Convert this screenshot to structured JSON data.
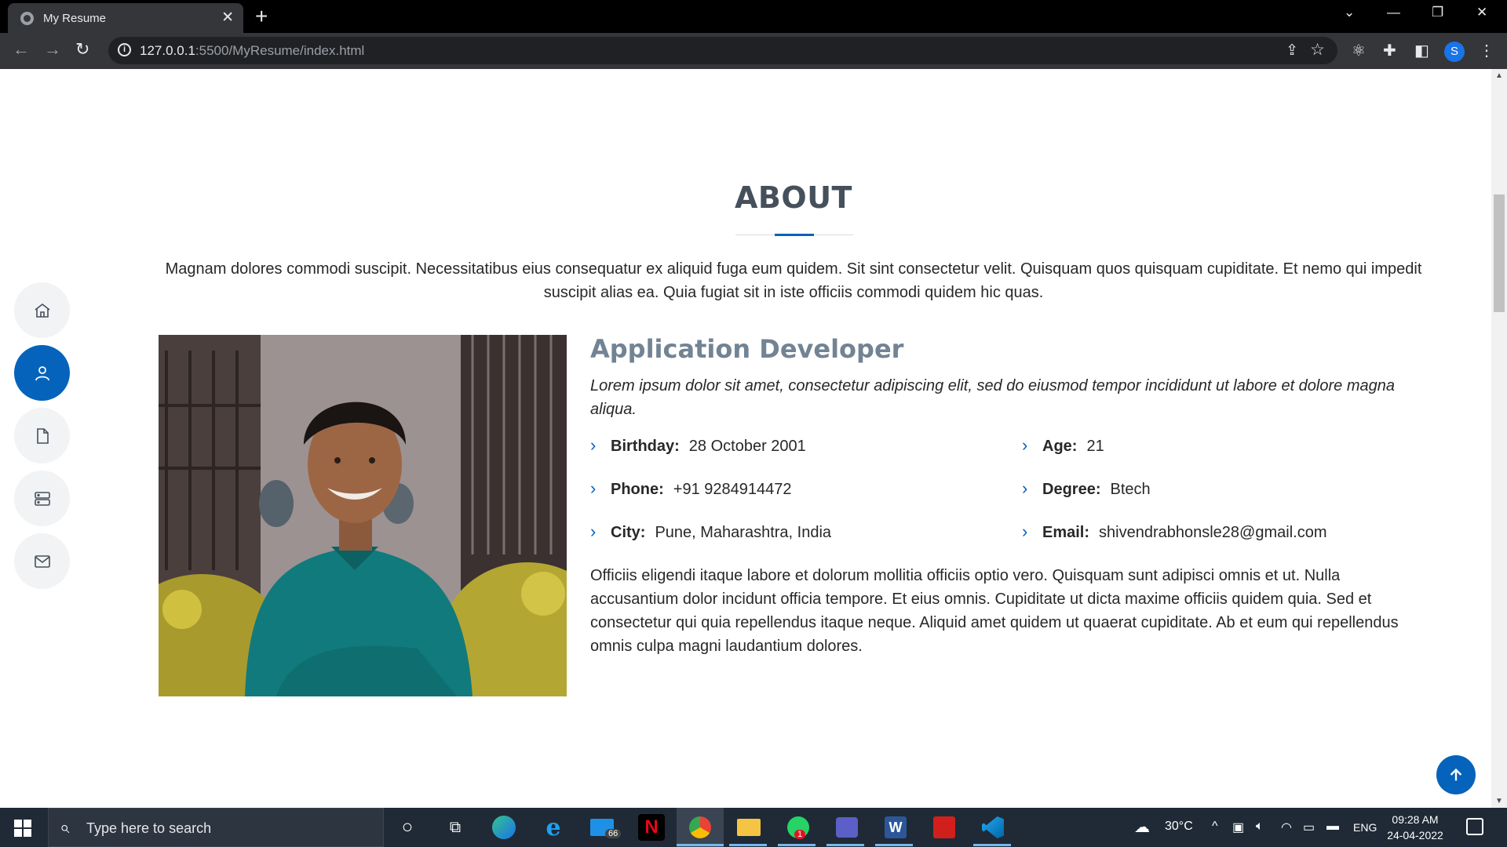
{
  "browser": {
    "tab_title": "My Resume",
    "url_host": "127.0.0.1",
    "url_rest": ":5500/MyResume/index.html",
    "profile_initial": "S"
  },
  "about": {
    "heading": "ABOUT",
    "intro": "Magnam dolores commodi suscipit. Necessitatibus eius consequatur ex aliquid fuga eum quidem. Sit sint consectetur velit. Quisquam quos quisquam cupiditate. Et nemo qui impedit suscipit alias ea. Quia fugiat sit in iste officiis commodi quidem hic quas.",
    "role": "Application Developer",
    "tagline": "Lorem ipsum dolor sit amet, consectetur adipiscing elit, sed do eiusmod tempor incididunt ut labore et dolore magna aliqua.",
    "details": {
      "birthday": {
        "label": "Birthday:",
        "value": "28 October 2001"
      },
      "phone": {
        "label": "Phone:",
        "value": "+91 9284914472"
      },
      "city": {
        "label": "City:",
        "value": "Pune, Maharashtra, India"
      },
      "age": {
        "label": "Age:",
        "value": "21"
      },
      "degree": {
        "label": "Degree:",
        "value": "Btech"
      },
      "email": {
        "label": "Email:",
        "value": "shivendrabhonsle28@gmail.com"
      }
    },
    "bio": "Officiis eligendi itaque labore et dolorum mollitia officiis optio vero. Quisquam sunt adipisci omnis et ut. Nulla accusantium dolor incidunt officia tempore. Et eius omnis. Cupiditate ut dicta maxime officiis quidem quia. Sed et consectetur qui quia repellendus itaque neque. Aliquid amet quidem ut quaerat cupiditate. Ab et eum qui repellendus omnis culpa magni laudantium dolores."
  },
  "sidenav": {
    "items": [
      "home-icon",
      "person-icon",
      "file-icon",
      "server-icon",
      "envelope-icon"
    ],
    "active": "person-icon"
  },
  "colors": {
    "accent": "#0563bb",
    "heading": "#45505b",
    "role": "#728394"
  },
  "taskbar": {
    "search_placeholder": "Type here to search",
    "mail_badge": "66",
    "whatsapp_badge": "1",
    "temperature": "30°C",
    "language": "ENG",
    "time": "09:28 AM",
    "date": "24-04-2022"
  }
}
